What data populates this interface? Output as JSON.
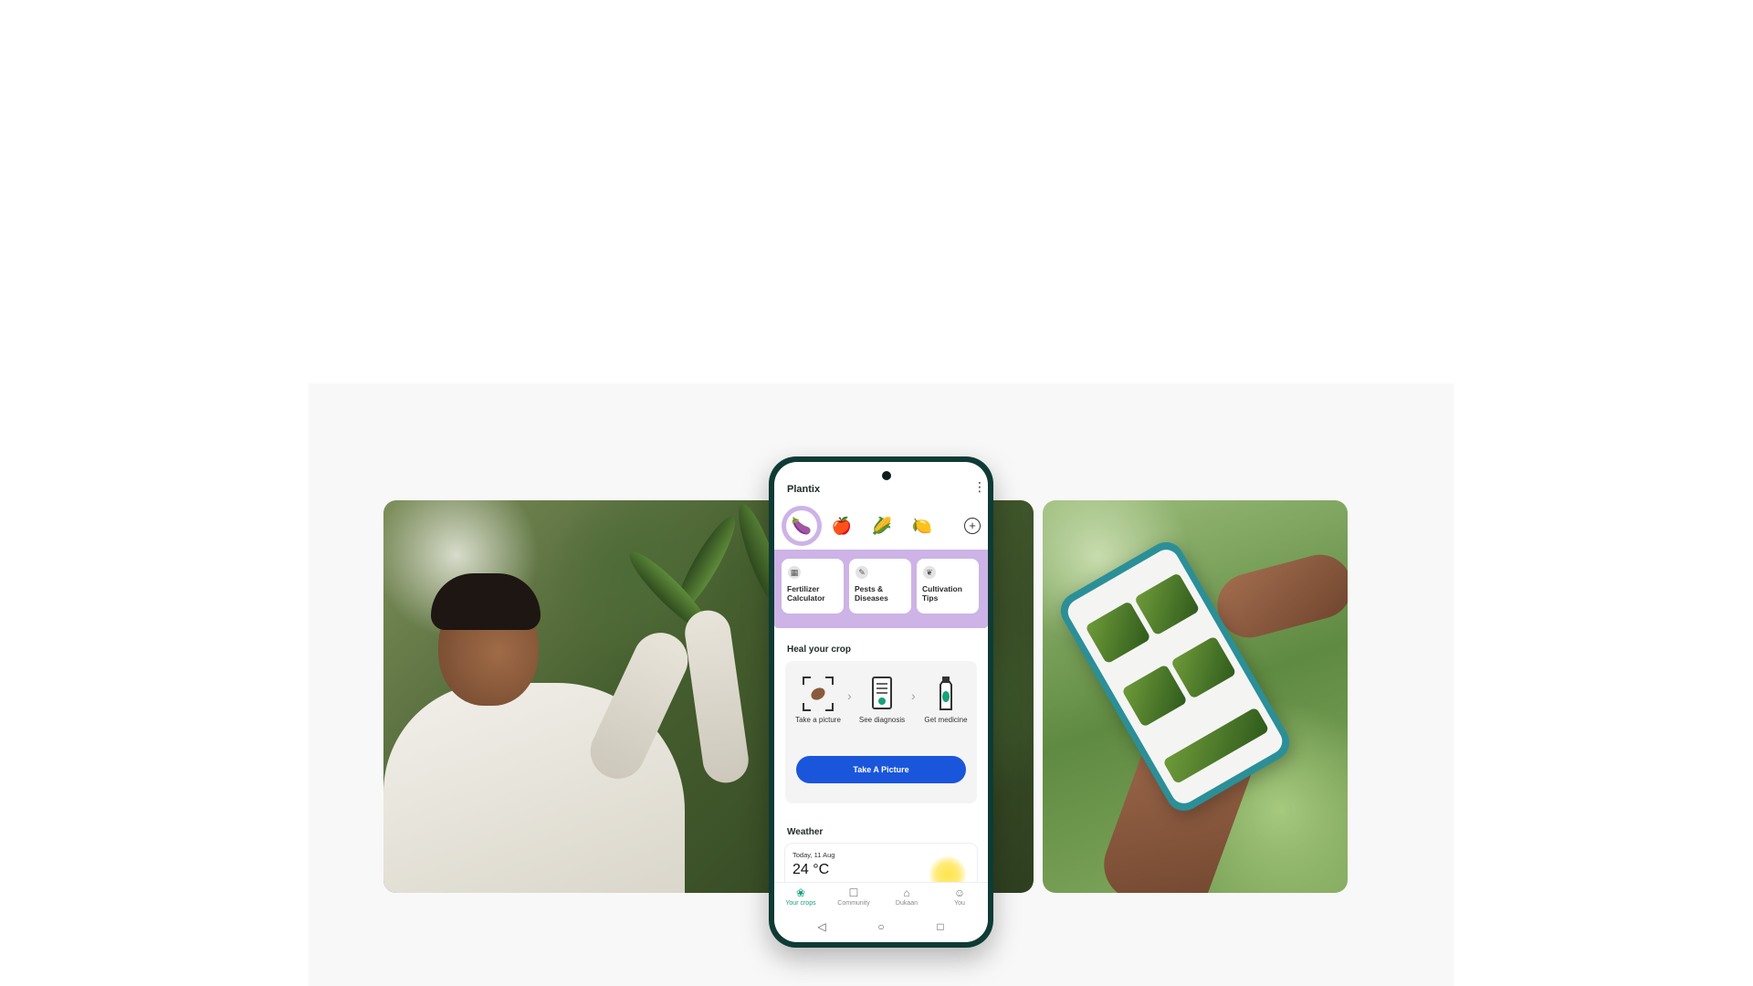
{
  "app": {
    "title": "Plantix"
  },
  "crops": [
    {
      "name": "eggplant-icon",
      "glyph": "🍆",
      "active": true
    },
    {
      "name": "apple-icon",
      "glyph": "🍎",
      "active": false
    },
    {
      "name": "corn-icon",
      "glyph": "🌽",
      "active": false
    },
    {
      "name": "lemon-icon",
      "glyph": "🍋",
      "active": false
    }
  ],
  "tools": [
    {
      "label": "Fertilizer Calculator",
      "icon": "calculator-icon"
    },
    {
      "label": "Pests & Diseases",
      "icon": "bug-icon"
    },
    {
      "label": "Cultivation Tips",
      "icon": "plant-icon"
    }
  ],
  "heal": {
    "title": "Heal your crop",
    "steps": [
      {
        "label": "Take a picture",
        "icon": "camera-scan-icon"
      },
      {
        "label": "See diagnosis",
        "icon": "document-check-icon"
      },
      {
        "label": "Get medicine",
        "icon": "bottle-icon"
      }
    ],
    "button_label": "Take A Picture"
  },
  "weather": {
    "title": "Weather",
    "date": "Today, 11 Aug",
    "temperature": "24 °C"
  },
  "nav": [
    {
      "label": "Your crops",
      "icon": "sprout-icon",
      "active": true
    },
    {
      "label": "Community",
      "icon": "community-icon",
      "active": false
    },
    {
      "label": "Dukaan",
      "icon": "shop-icon",
      "active": false
    },
    {
      "label": "You",
      "icon": "profile-icon",
      "active": false
    }
  ],
  "colors": {
    "accent_purple": "#cdb3e6",
    "button_blue": "#1a56db",
    "nav_active": "#17a37a",
    "phone_frame": "#0f3b35"
  }
}
